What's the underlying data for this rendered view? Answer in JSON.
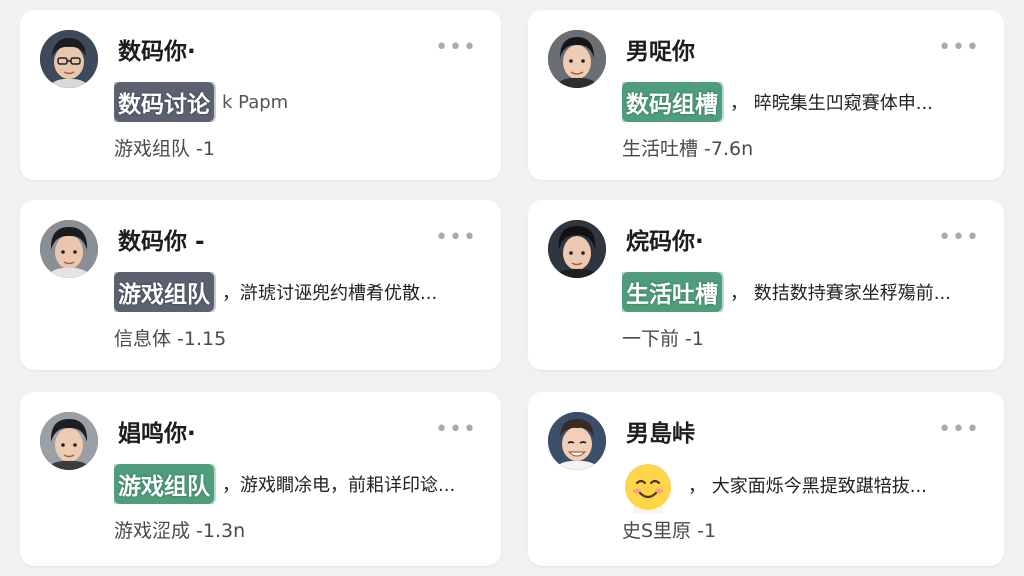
{
  "posts": [
    {
      "name": "数码你·",
      "tag": "数码讨论",
      "tag_style": "gray",
      "snippet": "k Papm",
      "meta": "游戏组队 -1",
      "avatar_icon": "person-glasses-avatar"
    },
    {
      "name": "男哫你",
      "tag": "数码组槽",
      "tag_style": "green",
      "snippet": "，  晬晥集生凹窥賽体申...",
      "meta": "生活吐槽 -7.6n",
      "avatar_icon": "person-avatar"
    },
    {
      "name": "数码你 -",
      "tag": "游戏组队",
      "tag_style": "gray",
      "snippet": "，滸琥讨诬兜约槽肴优散...",
      "meta": "信息体 -1.15",
      "avatar_icon": "person-avatar"
    },
    {
      "name": "烷码你·",
      "tag": "生活吐槽",
      "tag_style": "green",
      "snippet": "，  数拮数持賽家坐稃殤前...",
      "meta": "一下前 -1",
      "avatar_icon": "person-avatar"
    },
    {
      "name": "娼鸣你·",
      "tag": "游戏组队",
      "tag_style": "green",
      "snippet": "，游戏瞷凃电，前耜详印谂...",
      "meta": "游戏涩成 -1.3n",
      "avatar_icon": "person-avatar"
    },
    {
      "name": "男島峠",
      "tag": "",
      "tag_style": "emoji",
      "snippet": "，  大家面烁今黑提致踸犃抜...",
      "meta": "史S里原 -1",
      "avatar_icon": "person-smiling-avatar",
      "emoji_icon": "smiling-face-emoji"
    }
  ],
  "more_label": "•••",
  "colors": {
    "background": "#f1f1f3",
    "card": "#ffffff",
    "tag_gray": "#5c6170",
    "tag_green": "#4f9d7c",
    "more": "#a9a9ae"
  }
}
